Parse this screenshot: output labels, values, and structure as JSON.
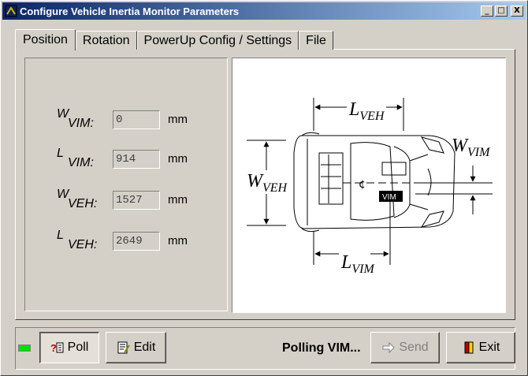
{
  "window": {
    "title": "Configure Vehicle Inertia Monitor Parameters",
    "controls": {
      "minimize": "_",
      "maximize": "□",
      "close": "X"
    }
  },
  "tabs": [
    {
      "label": "Position",
      "active": true
    },
    {
      "label": "Rotation",
      "active": false
    },
    {
      "label": "PowerUp Config / Settings",
      "active": false
    },
    {
      "label": "File",
      "active": false
    }
  ],
  "fields": [
    {
      "main": "W",
      "sub": "VIM:",
      "value": "0",
      "unit": "mm"
    },
    {
      "main": "L",
      "sub": "VIM:",
      "value": "914",
      "unit": "mm"
    },
    {
      "main": "W",
      "sub": "VEH:",
      "value": "1527",
      "unit": "mm"
    },
    {
      "main": "L",
      "sub": "VEH:",
      "value": "2649",
      "unit": "mm"
    }
  ],
  "diagram": {
    "labels": {
      "l_veh": {
        "main": "L",
        "sub": "VEH"
      },
      "w_veh": {
        "main": "W",
        "sub": "VEH"
      },
      "w_vim": {
        "main": "W",
        "sub": "VIM"
      },
      "l_vim": {
        "main": "L",
        "sub": "VIM"
      },
      "vim_box": "VIM",
      "centerline": "¢"
    }
  },
  "bottom": {
    "poll_label": "Poll",
    "edit_label": "Edit",
    "status": "Polling VIM...",
    "send_label": "Send",
    "exit_label": "Exit"
  },
  "colors": {
    "titlebar_start": "#0a246a",
    "titlebar_end": "#a6caf0",
    "led": "#00e000"
  }
}
